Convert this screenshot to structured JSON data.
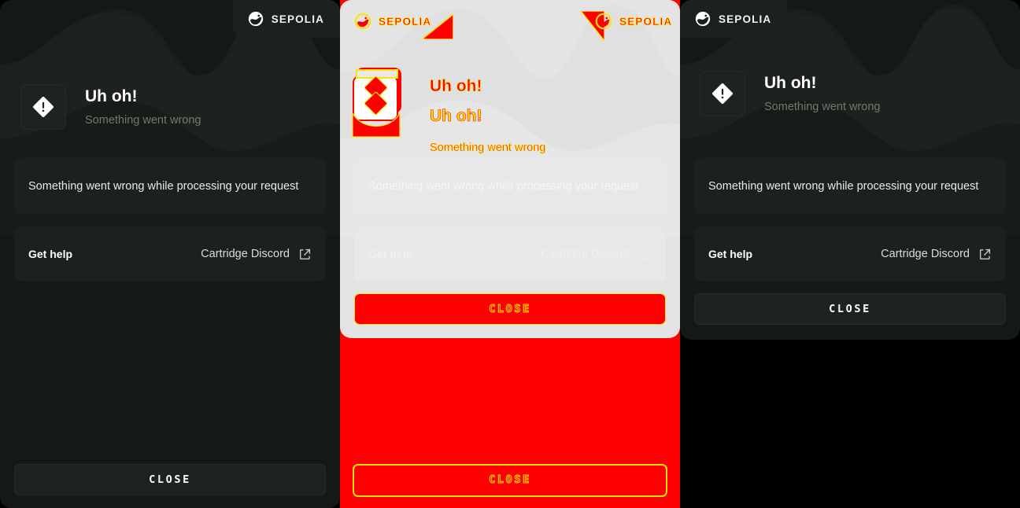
{
  "meta": {
    "view": "visual-regression-diff",
    "panels": [
      "baseline",
      "diff",
      "current"
    ]
  },
  "colors": {
    "app_background": "#141915",
    "surface": "#1b211c",
    "tile": "#1e231f",
    "text_primary": "#ffffff",
    "text_muted": "#6f7a71",
    "diff_added": "#ff0000",
    "diff_removed": "#ffe400",
    "diff_canvas": "#e4e4e4"
  },
  "network_badge": {
    "label": "SEPOLIA",
    "icon": "network-globe-icon"
  },
  "error": {
    "icon": "warning-diamond-icon",
    "title": "Uh oh!",
    "subtitle": "Something went wrong",
    "detail": "Something went wrong while processing your request"
  },
  "help": {
    "label": "Get help",
    "link_text": "Cartridge Discord",
    "link_icon": "external-link-icon"
  },
  "actions": {
    "close_label": "CLOSE"
  },
  "baseline": {
    "badge_position": "top-right",
    "close_position": "bottom"
  },
  "current": {
    "badge_position": "top-left",
    "close_position": "in-card"
  }
}
